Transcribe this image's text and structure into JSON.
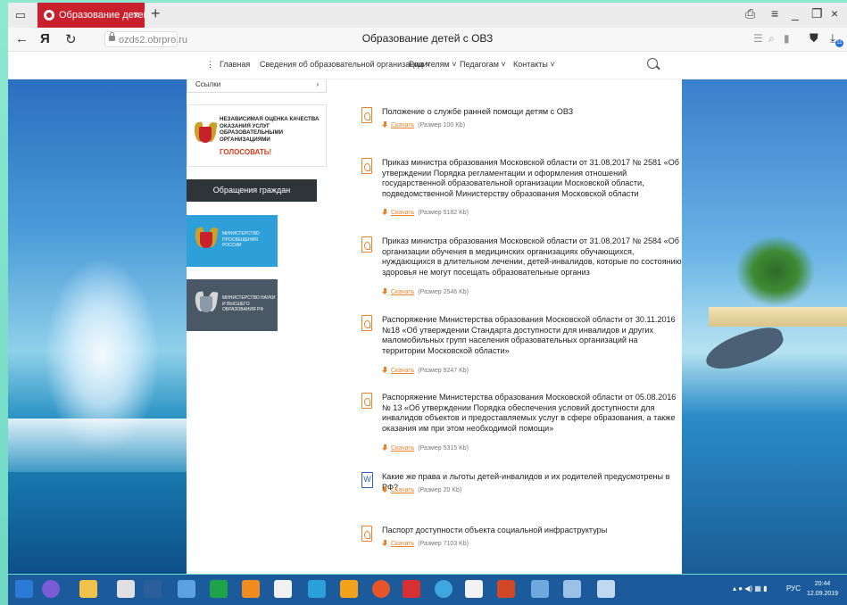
{
  "browser": {
    "tab_title": "Образование детей с С",
    "tab_close": "×",
    "new_tab": "+",
    "back": "←",
    "yandex_logo": "Я",
    "reload": "↻",
    "url": "ozds2.obrpro.ru",
    "page_title": "Образование детей с ОВЗ",
    "download_count": "11"
  },
  "site_nav": {
    "menu_glyph": "⋮",
    "items": [
      "Главная",
      "Сведения об образовательной организации ˅",
      "Родителям ˅",
      "Педагогам ˅",
      "Контакты ˅"
    ]
  },
  "sidebar": {
    "links_label": "Ссылки",
    "links_chevron": "›",
    "nok_text": "Независимая оценка качества оказания услуг образовательными организациями",
    "nok_vote": "ГОЛОСОВАТЬ!",
    "appeals_button": "Обращения граждан",
    "banner1_text": "Министерство просвещения России",
    "banner2_text": "Министерство науки и высшего образования РФ"
  },
  "download_label": "Скачать",
  "documents": [
    {
      "icon": "pdf-icon",
      "title": "Положение о службе ранней помощи детям с ОВЗ",
      "size": "(Размер 100 Kb)"
    },
    {
      "icon": "pdf-icon",
      "title": "Приказ министра образования Московской области от 31.08.2017 № 2581 «Об утверждении Порядка регламентации и оформления отношений государственной образовательной организации Московской области, подведомственной Министерству образования Московской области",
      "size": "(Размер 5182 Kb)"
    },
    {
      "icon": "pdf-icon",
      "title": "Приказ министра образования Московской области от 31.08.2017 № 2584 «Об организации обучения в медицинских организациях обучающихся, нуждающихся в длительном лечении, детей-инвалидов, которые по состоянию здоровья не могут посещать образовательные организ",
      "size": "(Размер 2546 Kb)"
    },
    {
      "icon": "pdf-icon",
      "title": "Распоряжение Министерства образования Московской области от 30.11.2016 №18 «Об утверждении Стандарта доступности для инвалидов и других маломобильных групп населения образовательных организаций на территории Московской области»",
      "size": "(Размер 9247 Kb)"
    },
    {
      "icon": "pdf-icon",
      "title": "Распоряжение Министерства образования Московской области от 05.08.2016 № 13 «Об утверждении Порядка обеспечения условий доступности для инвалидов объектов и предоставляемых услуг в сфере образования, а также оказания им при этом необходимой помощи»",
      "size": "(Размер 5315 Kb)"
    },
    {
      "icon": "word-icon",
      "title": "Какие же права и льготы детей-инвалидов и их родителей предусмотрены в РФ?",
      "size": "(Размер 20 Kb)"
    },
    {
      "icon": "pdf-icon",
      "title": "Паспорт доступности объекта социальной инфраструктуры",
      "size": "(Размер 7103 Kb)"
    }
  ],
  "taskbar": {
    "lang": "РУС",
    "time": "20:44",
    "date": "12.09.2019"
  }
}
